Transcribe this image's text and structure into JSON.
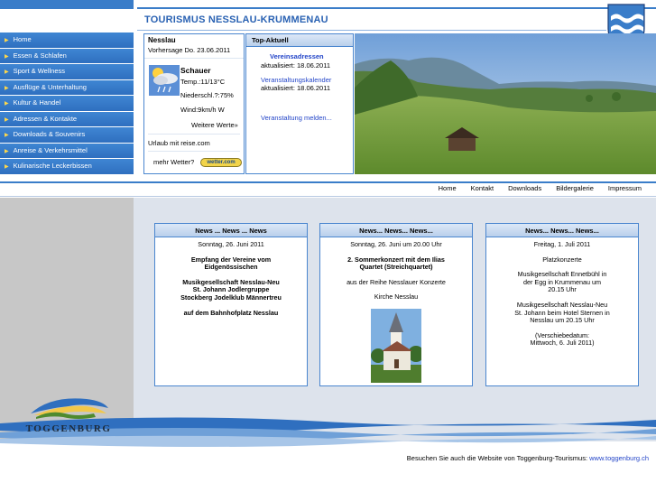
{
  "header": {
    "title": "TOURISMUS NESSLAU-KRUMMENAU"
  },
  "nav": {
    "items": [
      {
        "label": "Home"
      },
      {
        "label": "Essen & Schlafen"
      },
      {
        "label": "Sport & Wellness"
      },
      {
        "label": "Ausflüge & Unterhaltung"
      },
      {
        "label": "Kultur & Handel"
      },
      {
        "label": "Adressen & Kontakte"
      },
      {
        "label": "Downloads & Souvenirs"
      },
      {
        "label": "Anreise & Verkehrsmittel"
      },
      {
        "label": "Kulinarische Leckerbissen"
      }
    ]
  },
  "weather": {
    "location": "Nesslau",
    "forecast": "Vorhersage Do. 23.06.2011",
    "condition": "Schauer",
    "temp": "Temp.:11/13°C",
    "rain": "Niederschl.?:75%",
    "wind": "Wind:9km/h W",
    "more": "Weitere Werte»",
    "ad": "Urlaub mit reise.com",
    "more_weather": "mehr Wetter?",
    "logo_text": "wetter.com"
  },
  "top_aktuell": {
    "title": "Top-Aktuell",
    "link1": "Vereinsadressen",
    "updated1": "aktualisiert: 18.06.2011",
    "link2": "Veranstaltungskalender",
    "updated2": "aktualisiert: 18.06.2011",
    "link3": "Veranstaltung melden..."
  },
  "topnav": {
    "items": [
      {
        "label": "Home"
      },
      {
        "label": "Kontakt"
      },
      {
        "label": "Downloads"
      },
      {
        "label": "Bildergalerie"
      },
      {
        "label": "Impressum"
      }
    ]
  },
  "news": [
    {
      "title": "News ... News ... News",
      "date": "Sonntag, 26. Juni 2011",
      "lines": [
        "Empfang der Vereine vom Eidgenössischen",
        "Musikgesellschaft Nesslau-Neu St. Johann Jodlergruppe Stockberg Jodelklub Männertreu",
        "auf dem Bahnhofplatz Nesslau"
      ]
    },
    {
      "title": "News... News... News...",
      "date": "Sonntag, 26. Juni um 20.00 Uhr",
      "lines": [
        "2. Sommerkonzert mit dem Ilias Quartet (Streichquartet)",
        "aus der Reihe Nesslauer Konzerte",
        "Kirche Nesslau"
      ]
    },
    {
      "title": "News... News... News...",
      "date": "Freitag, 1. Juli 2011",
      "lines": [
        "Platzkonzerte",
        "Musikgesellschaft Ennetbühl in der Egg in Krummenau um 20.15 Uhr",
        "Musikgesellschaft Nesslau-Neu St. Johann beim Hotel Sternen in Nesslau um 20.15 Uhr",
        "(Verschiebedatum: Mittwoch, 6. Juli 2011)"
      ]
    }
  ],
  "logo": {
    "text": "TOGGENBURG"
  },
  "footer": {
    "text": "Besuchen Sie auch die Website von Toggenburg-Tourismus:",
    "link": "www.toggenburg.ch"
  },
  "colors": {
    "accent": "#3a7dc9",
    "title": "#2a62b3",
    "link": "#2345c8",
    "main_bg": "#dde3ec",
    "left_bg": "#c7c7c7"
  }
}
